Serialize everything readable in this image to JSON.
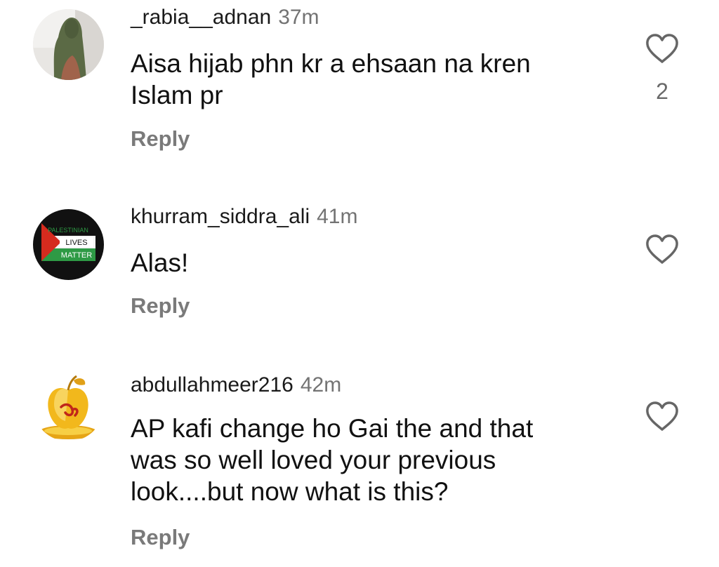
{
  "comments": [
    {
      "username": "_rabia__adnan",
      "time": "37m",
      "text": "Aisa hijab phn kr a ehsaan na kren\nIslam pr",
      "reply_label": "Reply",
      "like_count": "2",
      "avatar_icon": "hijab-woman-avatar"
    },
    {
      "username": "khurram_siddra_ali",
      "time": "41m",
      "text": "Alas!",
      "reply_label": "Reply",
      "avatar_icon": "palestine-flag-avatar",
      "avatar_text": [
        "PALESTINIAN",
        "LIVES",
        "MATTER"
      ]
    },
    {
      "username": "abdullahmeer216",
      "time": "42m",
      "text": "AP kafi change ho Gai the and that\nwas so well loved your previous\nlook....but now what is this?",
      "reply_label": "Reply",
      "avatar_icon": "golden-apple-avatar"
    }
  ],
  "colors": {
    "text": "#111111",
    "muted": "#737373",
    "reply": "#7a7a7a",
    "icon": "#666666"
  }
}
